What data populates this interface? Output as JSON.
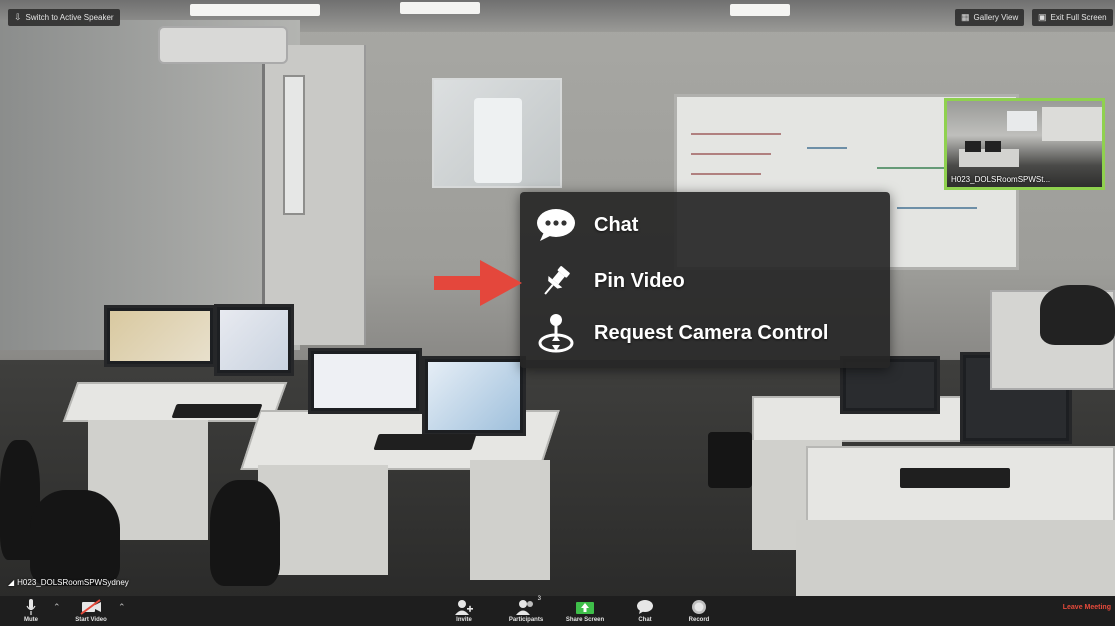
{
  "top_bar": {
    "switch_label": "Switch to Active Speaker",
    "gallery_label": "Gallery View",
    "exit_fullscreen_label": "Exit Full Screen"
  },
  "self_view": {
    "name": "H023_DOLSRoomSPWSt..."
  },
  "speaker": {
    "name": "H023_DOLSRoomSPWSydney"
  },
  "context_menu": {
    "items": [
      {
        "label": "Chat",
        "icon": "chat-bubble-icon"
      },
      {
        "label": "Pin Video",
        "icon": "pin-icon"
      },
      {
        "label": "Request Camera Control",
        "icon": "camera-control-icon"
      }
    ]
  },
  "toolbar": {
    "mute_label": "Mute",
    "start_video_label": "Start Video",
    "invite_label": "Invite",
    "participants_label": "Participants",
    "participants_count": "3",
    "share_screen_label": "Share Screen",
    "chat_label": "Chat",
    "record_label": "Record",
    "leave_label": "Leave Meeting"
  },
  "colors": {
    "accent_green": "#8fd14f",
    "share_green": "#3fbf4a",
    "leave_red": "#e54a3b",
    "arrow_red": "#e4473c"
  }
}
